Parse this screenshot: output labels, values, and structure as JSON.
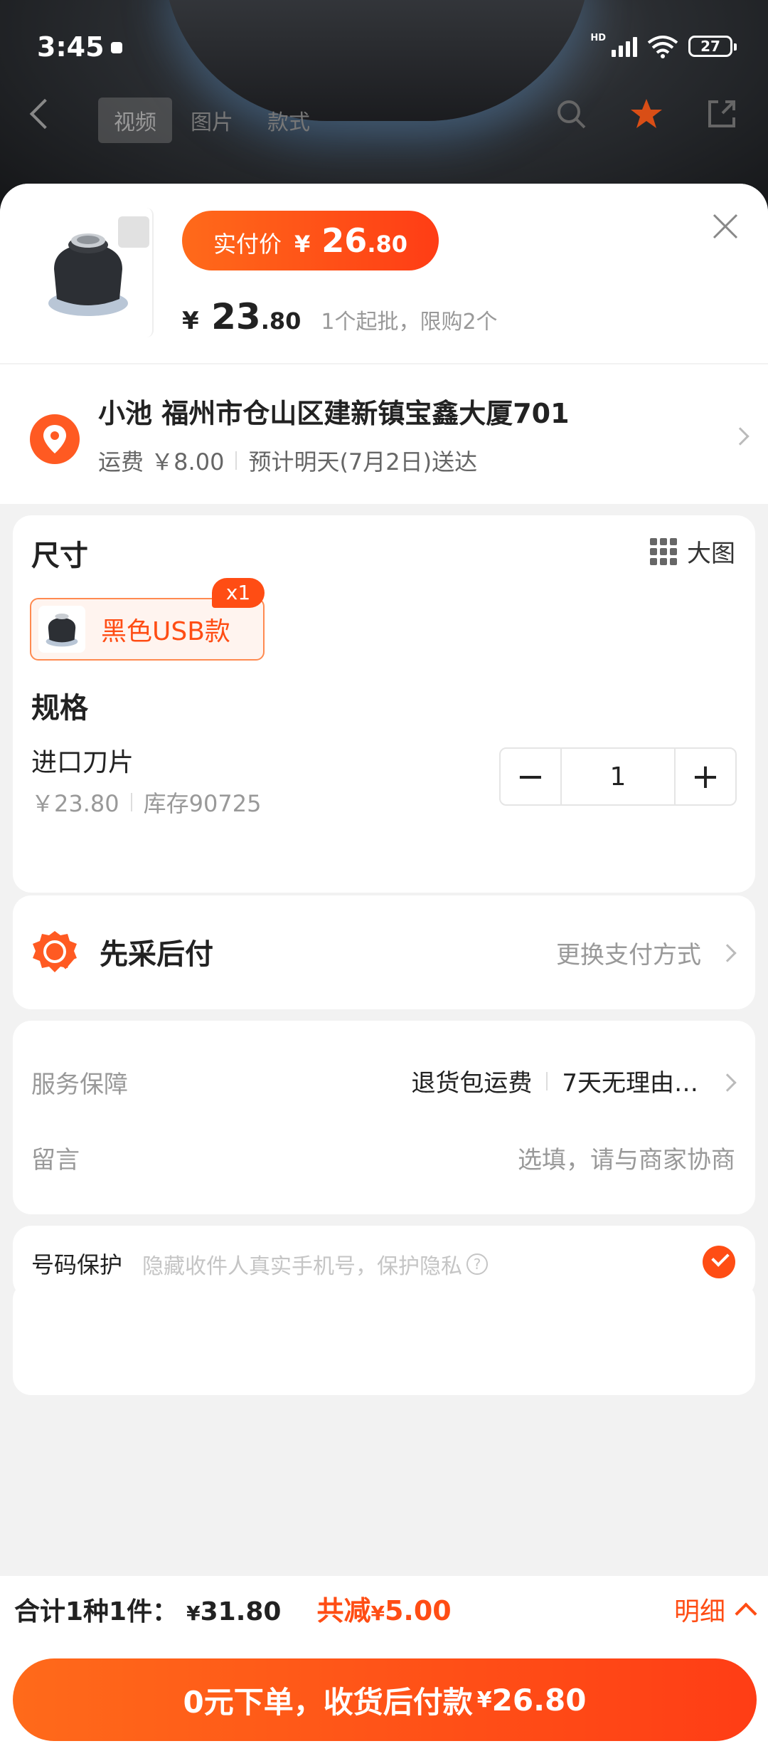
{
  "status_bar": {
    "time": "3:45",
    "network": "HD",
    "battery": "27"
  },
  "top_nav": {
    "tabs": [
      "视频",
      "图片",
      "款式"
    ]
  },
  "header": {
    "actual_price_label": "实付价",
    "actual_price_currency": "¥",
    "actual_price_int": "26",
    "actual_price_dec": ".80",
    "unit_price_currency": "¥",
    "unit_price_int": "23",
    "unit_price_dec": ".80",
    "batch_text": "1个起批，限购2个"
  },
  "address": {
    "line": "小池  福州市仓山区建新镇宝鑫大厦701",
    "shipping": "运费 ￥8.00",
    "delivery": "预计明天(7月2日)送达"
  },
  "size": {
    "title": "尺寸",
    "big_image_label": "大图",
    "option_label": "黑色USB款",
    "option_qty": "x1"
  },
  "spec": {
    "title": "规格",
    "item_name": "进口刀片",
    "item_price": "￥23.80",
    "item_stock": "库存90725",
    "quantity": "1",
    "minus": "−",
    "plus": "+"
  },
  "payment": {
    "label": "先采后付",
    "change": "更换支付方式"
  },
  "service": {
    "label": "服务保障",
    "tag1": "退货包运费",
    "tag2": "7天无理由…",
    "message_label": "留言",
    "message_placeholder": "选填，请与商家协商"
  },
  "privacy": {
    "label": "号码保护",
    "desc": "隐藏收件人真实手机号，保护隐私",
    "help": "?"
  },
  "footer": {
    "total_label": "合计1种1件：",
    "total_currency": "¥",
    "total_value": "31.80",
    "discount_label": "共减",
    "discount_currency": "¥",
    "discount_value": "5.00",
    "detail": "明细",
    "submit_main": "0元下单，收货后付款",
    "submit_currency": "¥",
    "submit_value": "26.80"
  },
  "colors": {
    "accent": "#ff4d14",
    "accent_light": "#ff6a1a"
  }
}
